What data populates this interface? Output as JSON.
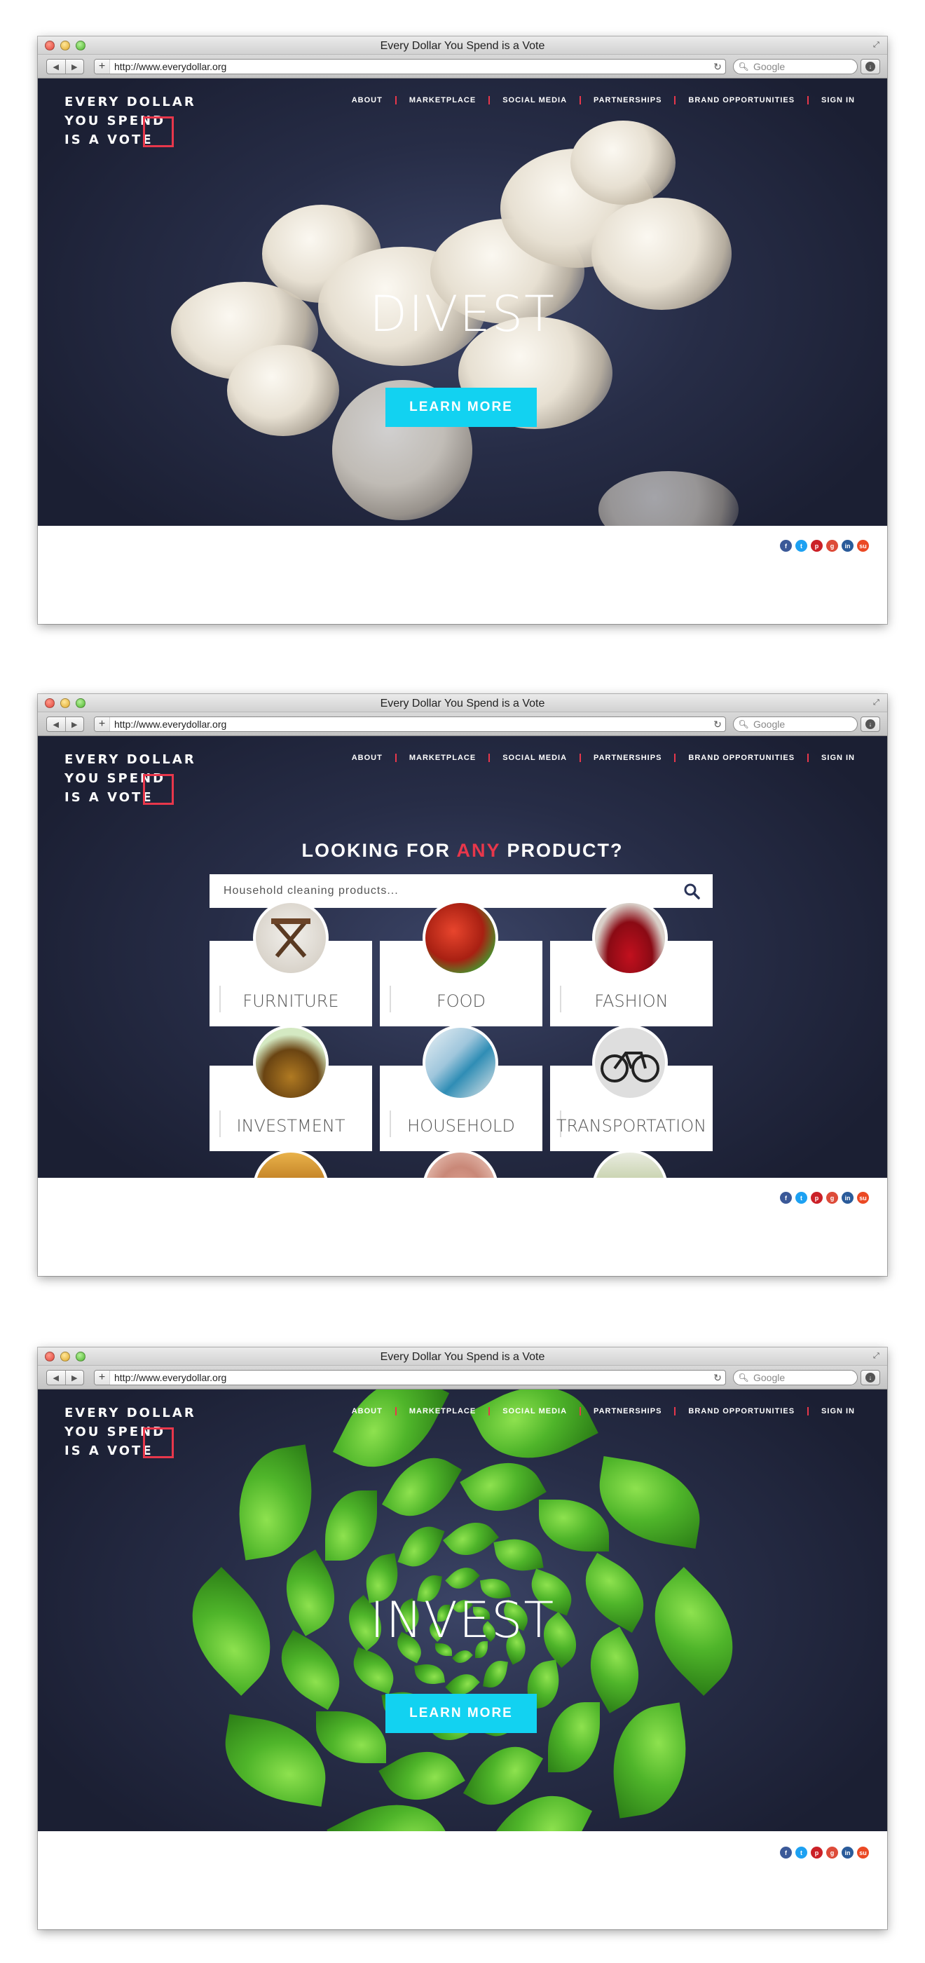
{
  "browser": {
    "window_title": "Every Dollar You Spend is a Vote",
    "url": "http://www.everydollar.org",
    "search_placeholder": "Google",
    "back_label": "◀",
    "forward_label": "▶",
    "add_label": "+",
    "reload_label": "↻"
  },
  "site": {
    "logo_line1": "EVERY DOLLAR",
    "logo_line2": "YOU SPEND",
    "logo_line3": "IS A VOTE",
    "nav": [
      "ABOUT",
      "MARKETPLACE",
      "SOCIAL MEDIA",
      "PARTNERSHIPS",
      "BRAND OPPORTUNITIES",
      "SIGN IN"
    ],
    "accent_color": "#e8374b",
    "cta_color": "#12d2f1",
    "social_icons": [
      {
        "name": "facebook-icon",
        "glyph": "f",
        "color": "#3b5998"
      },
      {
        "name": "twitter-icon",
        "glyph": "t",
        "color": "#1da1f2"
      },
      {
        "name": "pinterest-icon",
        "glyph": "p",
        "color": "#cb2027"
      },
      {
        "name": "googleplus-icon",
        "glyph": "g",
        "color": "#dd4b39"
      },
      {
        "name": "linkedin-icon",
        "glyph": "in",
        "color": "#2a5b9a"
      },
      {
        "name": "stumbleupon-icon",
        "glyph": "su",
        "color": "#eb4924"
      }
    ]
  },
  "screen1": {
    "hero_title": "DIVEST",
    "cta_label": "LEARN MORE"
  },
  "screen2": {
    "heading_pre": "LOOKING FOR ",
    "heading_accent": "ANY",
    "heading_post": " PRODUCT?",
    "search_placeholder": "Household cleaning products...",
    "categories": [
      "FURNITURE",
      "FOOD",
      "FASHION",
      "INVESTMENT",
      "HOUSEHOLD",
      "TRANSPORTATION"
    ]
  },
  "screen3": {
    "hero_title": "INVEST",
    "cta_label": "LEARN MORE"
  }
}
